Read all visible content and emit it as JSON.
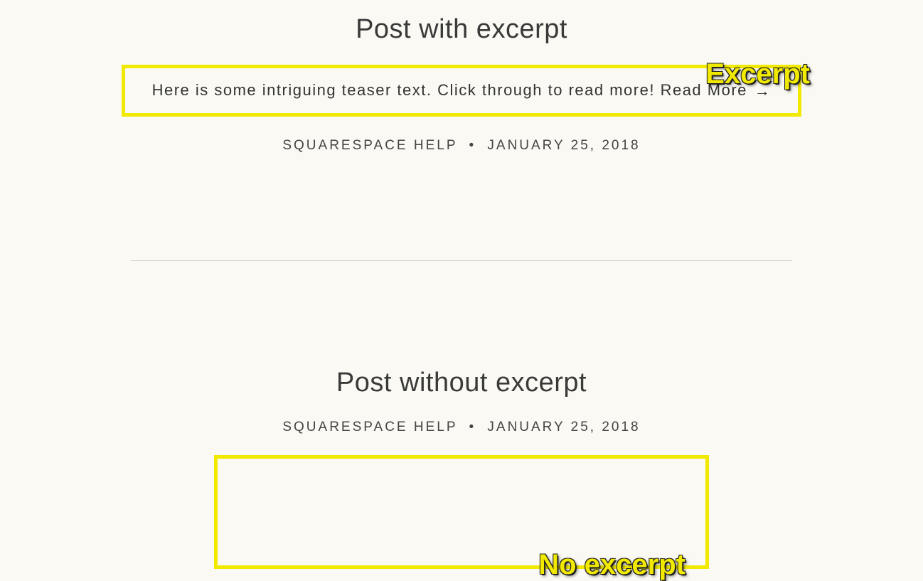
{
  "post1": {
    "title": "Post with excerpt",
    "excerpt_text": "Here is some intriguing teaser text. Click through to read more! ",
    "read_more": "Read More",
    "arrow": "→",
    "author": "SQUARESPACE HELP",
    "sep": "•",
    "date": "JANUARY 25, 2018",
    "annotation": "Excerpt"
  },
  "post2": {
    "title": "Post without excerpt",
    "author": "SQUARESPACE HELP",
    "sep": "•",
    "date": "JANUARY 25, 2018",
    "annotation": "No excerpt"
  }
}
